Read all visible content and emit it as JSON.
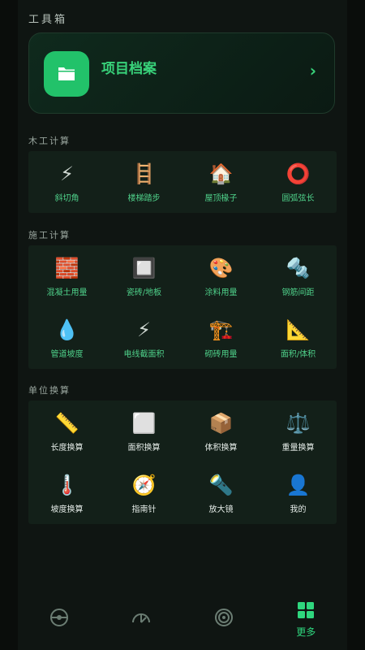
{
  "page": {
    "title": "工具箱"
  },
  "project_card": {
    "title": "项目档案",
    "arrow": "›"
  },
  "sections": [
    {
      "title": "木工计算",
      "items": [
        {
          "icon": "⚡",
          "label": "斜切角"
        },
        {
          "icon": "🪜",
          "label": "楼梯踏步"
        },
        {
          "icon": "🏠",
          "label": "屋顶椽子"
        },
        {
          "icon": "⭕",
          "label": "圆弧弦长"
        }
      ]
    },
    {
      "title": "施工计算",
      "items": [
        {
          "icon": "🧱",
          "label": "混凝土用量"
        },
        {
          "icon": "🔲",
          "label": "瓷砖/地板"
        },
        {
          "icon": "🎨",
          "label": "涂料用量"
        },
        {
          "icon": "🔩",
          "label": "钢筋间距"
        },
        {
          "icon": "💧",
          "label": "管道坡度"
        },
        {
          "icon": "⚡",
          "label": "电线截面积"
        },
        {
          "icon": "🏗️",
          "label": "砌砖用量"
        },
        {
          "icon": "📐",
          "label": "面积/体积"
        }
      ]
    },
    {
      "title": "单位换算",
      "items": [
        {
          "icon": "📏",
          "label": "长度换算"
        },
        {
          "icon": "⬜",
          "label": "面积换算"
        },
        {
          "icon": "📦",
          "label": "体积换算"
        },
        {
          "icon": "⚖️",
          "label": "重量换算"
        },
        {
          "icon": "🌡️",
          "label": "坡度换算"
        },
        {
          "icon": "🧭",
          "label": "指南针"
        },
        {
          "icon": "🔦",
          "label": "放大镜"
        },
        {
          "icon": "👤",
          "label": "我的"
        }
      ]
    }
  ],
  "tab_bar": {
    "tabs": [
      {
        "icon": "level-icon",
        "label": ""
      },
      {
        "icon": "protractor-icon",
        "label": ""
      },
      {
        "icon": "target-icon",
        "label": ""
      },
      {
        "icon": "grid-icon",
        "label": "更多"
      }
    ]
  },
  "colors": {
    "accent": "#2fd67e",
    "label": "#4fd18a",
    "icon_muted": "#6b7d73"
  }
}
